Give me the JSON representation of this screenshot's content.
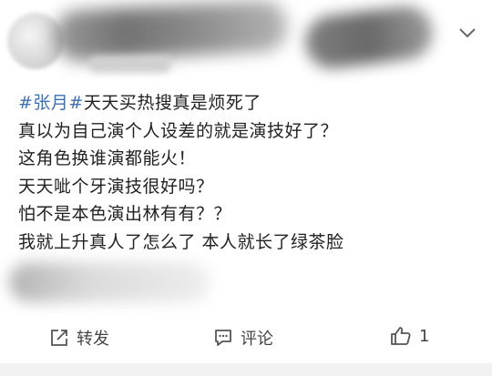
{
  "post": {
    "hashtag": "#张月#",
    "lines": [
      "天天买热搜真是烦死了",
      "真以为自己演个人设差的就是演技好了？",
      "这角色换谁演都能火！",
      "天天呲个牙演技很好吗？",
      "怕不是本色演出林有有？？",
      "我就上升真人了怎么了 本人就长了绿茶脸"
    ]
  },
  "actions": {
    "repost_label": "转发",
    "comment_label": "评论",
    "like_count": "1"
  },
  "colors": {
    "hashtag": "#3f6fb5",
    "text": "#222222",
    "action_text": "#444444",
    "icon_stroke": "#555555"
  }
}
